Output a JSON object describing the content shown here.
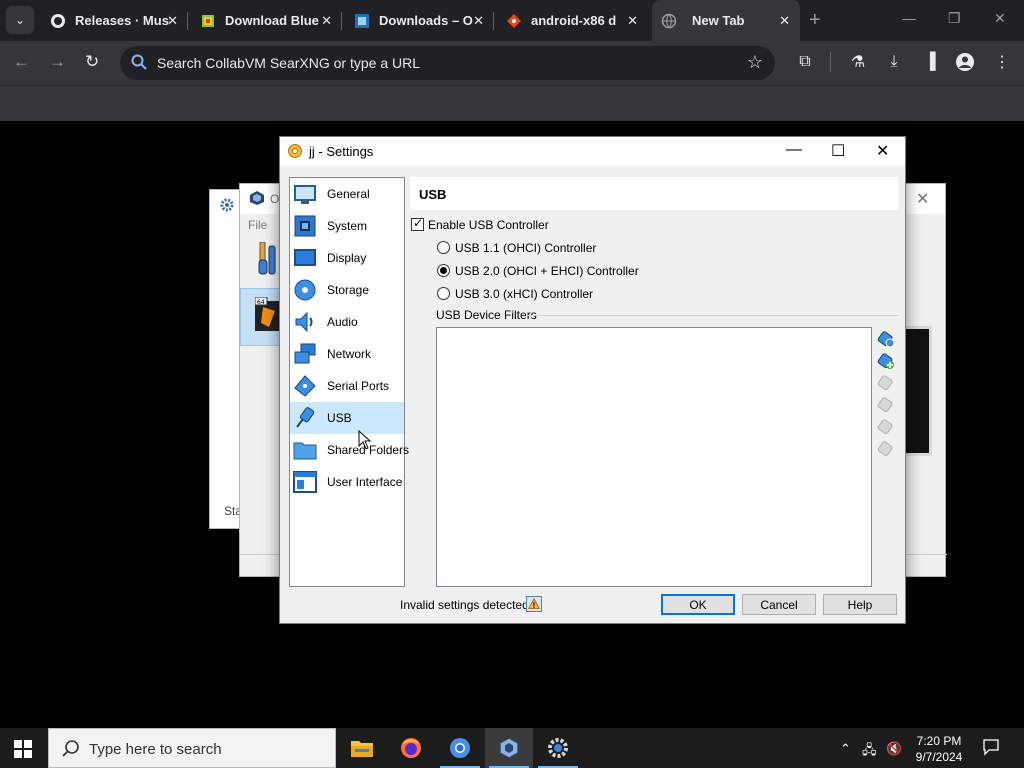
{
  "browser": {
    "tabs": [
      {
        "title": "Releases · Musi",
        "favicon": "github-icon"
      },
      {
        "title": "Download Blue",
        "favicon": "bluestacks-icon"
      },
      {
        "title": "Downloads – O",
        "favicon": "virtualbox-icon"
      },
      {
        "title": "android-x86 d",
        "favicon": "git-icon"
      },
      {
        "title": "New Tab",
        "favicon": "globe-icon",
        "active": true
      }
    ],
    "omnibox_placeholder": "Search CollabVM SearXNG or type a URL"
  },
  "bg_window": {
    "title_partial": "O",
    "menu_file": "File",
    "status_partial": "Sta"
  },
  "dialog": {
    "title": "jj - Settings",
    "nav": [
      {
        "label": "General",
        "icon": "general-icon"
      },
      {
        "label": "System",
        "icon": "system-icon"
      },
      {
        "label": "Display",
        "icon": "display-icon"
      },
      {
        "label": "Storage",
        "icon": "storage-icon"
      },
      {
        "label": "Audio",
        "icon": "audio-icon"
      },
      {
        "label": "Network",
        "icon": "network-icon"
      },
      {
        "label": "Serial Ports",
        "icon": "serial-ports-icon"
      },
      {
        "label": "USB",
        "icon": "usb-icon",
        "selected": true
      },
      {
        "label": "Shared Folders",
        "icon": "shared-folders-icon"
      },
      {
        "label": "User Interface",
        "icon": "user-interface-icon"
      }
    ],
    "page_title": "USB",
    "enable_usb": {
      "label": "Enable USB Controller",
      "checked": true
    },
    "controllers": [
      {
        "label": "USB 1.1 (OHCI) Controller",
        "selected": false
      },
      {
        "label": "USB 2.0 (OHCI + EHCI) Controller",
        "selected": true
      },
      {
        "label": "USB 3.0 (xHCI) Controller",
        "selected": false
      }
    ],
    "filters_label": "USB Device Filters",
    "invalid_text": "Invalid settings detected",
    "buttons": {
      "ok": "OK",
      "cancel": "Cancel",
      "help": "Help"
    }
  },
  "taskbar": {
    "search_placeholder": "Type here to search",
    "time": "7:20 PM",
    "date": "9/7/2024"
  }
}
